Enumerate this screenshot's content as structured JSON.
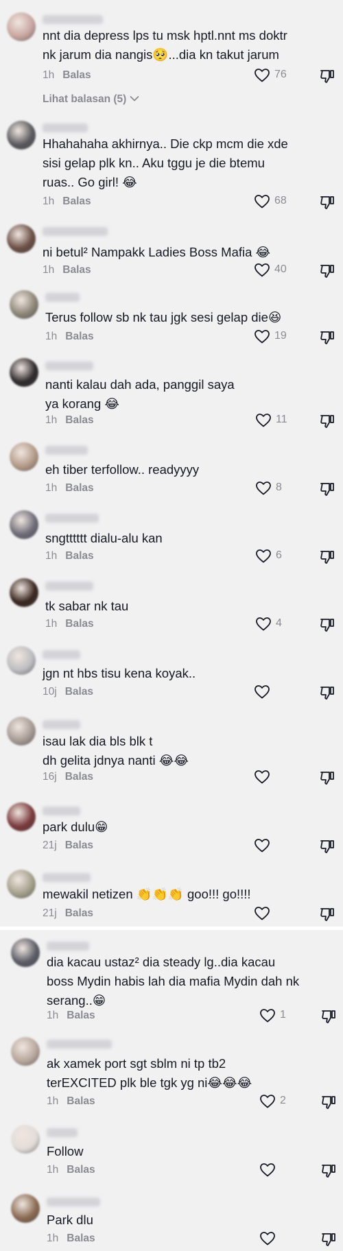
{
  "reply_label": "Balas",
  "view_replies_label": "Lihat balasan (5)",
  "colors": {
    "background": "#f1f1f2",
    "text": "#161823",
    "muted": "#8a8b91",
    "divider": "#ffffff"
  },
  "comments": [
    {
      "text": "nnt dia depress lps tu msk hptl.nnt ms doktr nk jarum dia nangis🥺...dia kn takut jarum",
      "time": "1h",
      "likes": "76",
      "avatar_color": "#c9a6a0"
    },
    {
      "text": "Hhahahaha akhirnya.. Die ckp mcm die xde sisi gelap plk kn.. Aku tggu je die btemu ruas.. Go girl! 😂",
      "time": "1h",
      "likes": "68",
      "avatar_color": "#5a5a5e"
    },
    {
      "text": "ni betul² Nampakk Ladies Boss Mafia 😂",
      "time": "1h",
      "likes": "40",
      "avatar_color": "#6b4f45"
    },
    {
      "text": "Terus follow sb nk tau jgk sesi gelap die😆",
      "time": "1h",
      "likes": "19",
      "avatar_color": "#8c8576"
    },
    {
      "text": "nanti kalau dah ada, panggil saya ya korang 😂",
      "time": "1h",
      "likes": "11",
      "avatar_color": "#2f2a2c"
    },
    {
      "text": "eh tiber terfollow.. readyyyy",
      "time": "1h",
      "likes": "8",
      "avatar_color": "#b39a88"
    },
    {
      "text": "sngtttttt dialu-alu kan",
      "time": "1h",
      "likes": "6",
      "avatar_color": "#6e6c78"
    },
    {
      "text": "tk sabar nk tau",
      "time": "1h",
      "likes": "4",
      "avatar_color": "#3a2620"
    },
    {
      "text": "jgn nt hbs tisu kena koyak..",
      "time": "10j",
      "likes": "",
      "avatar_color": "#bdbdc0"
    },
    {
      "text": "isau lak dia bls blk t\ndh gelita jdnya nanti 😂😂",
      "time": "16j",
      "likes": "",
      "avatar_color": "#a69a94"
    },
    {
      "text": "park dulu😁",
      "time": "21j",
      "likes": "",
      "avatar_color": "#7a3a3c"
    },
    {
      "text": "mewakil netizen 👏👏👏 goo!!! go!!!!",
      "time": "21j",
      "likes": "",
      "avatar_color": "#a4a08c"
    },
    {
      "text": "dia kacau ustaz² dia steady lg..dia kacau boss Mydin habis lah dia mafia Mydin dah nk serang..😁",
      "time": "1h",
      "likes": "1",
      "avatar_color": "#5b5c66"
    },
    {
      "text": "ak xamek port sgt sblm ni tp tb2\nterEXCITED plk ble tgk yg ni😂😂😂",
      "time": "1h",
      "likes": "2",
      "avatar_color": "#b8a79c"
    },
    {
      "text": "Follow",
      "time": "1h",
      "likes": "",
      "avatar_color": "#e2dcd8"
    },
    {
      "text": "Park dlu",
      "time": "1h",
      "likes": "",
      "avatar_color": "#8a6a52"
    }
  ]
}
